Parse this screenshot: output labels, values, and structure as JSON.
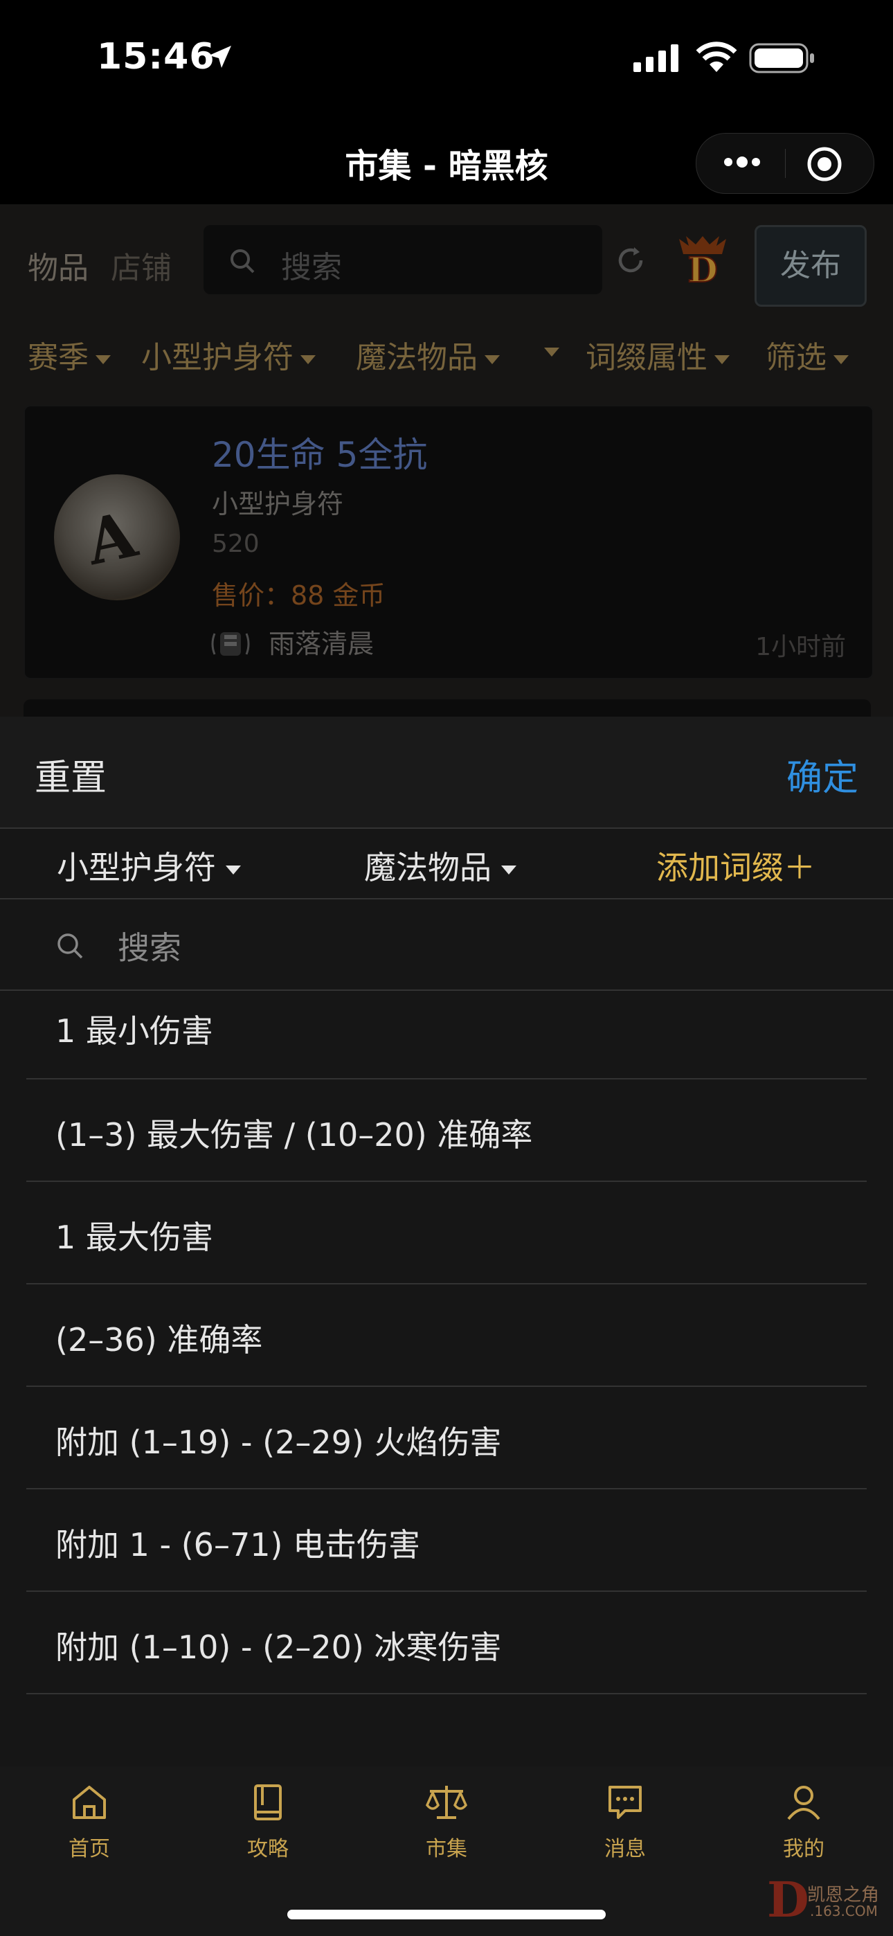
{
  "status_bar": {
    "time": "15:46"
  },
  "navbar": {
    "title": "市集 - 暗黑核"
  },
  "market": {
    "tab_items": "物品",
    "tab_shops": "店铺",
    "search_placeholder": "搜索",
    "publish_label": "发布",
    "filters": {
      "season": "赛季",
      "item_type": "小型护身符",
      "quality": "魔法物品",
      "affix": "词缀属性",
      "filter": "筛选"
    },
    "listing": {
      "name": "20生命 5全抗",
      "type": "小型护身符",
      "code": "520",
      "price": "售价：88 金币",
      "seller": "雨落清晨",
      "time_ago": "1小时前"
    }
  },
  "sheet": {
    "reset_label": "重置",
    "confirm_label": "确定",
    "item_type_select": "小型护身符",
    "quality_select": "魔法物品",
    "add_affix_label": "添加词缀＋",
    "search_placeholder": "搜索",
    "affixes": [
      "1 最小伤害",
      "(1–3) 最大伤害 / (10–20) 准确率",
      "1 最大伤害",
      "(2–36) 准确率",
      "附加 (1–19) - (2–29) 火焰伤害",
      "附加 1 - (6–71) 电击伤害",
      "附加 (1–10) - (2–20) 冰寒伤害"
    ]
  },
  "tabbar": {
    "home": "首页",
    "guide": "攻略",
    "market": "市集",
    "messages": "消息",
    "mine": "我的"
  },
  "watermark": {
    "letter": "D",
    "line1": "凯恩之角",
    "line2": ".163.COM"
  },
  "colors": {
    "accent_gold": "#c9a44f",
    "confirm_blue": "#2f8fe0",
    "magic_blue": "#5a74b4",
    "price_orange": "#9c5c26"
  }
}
